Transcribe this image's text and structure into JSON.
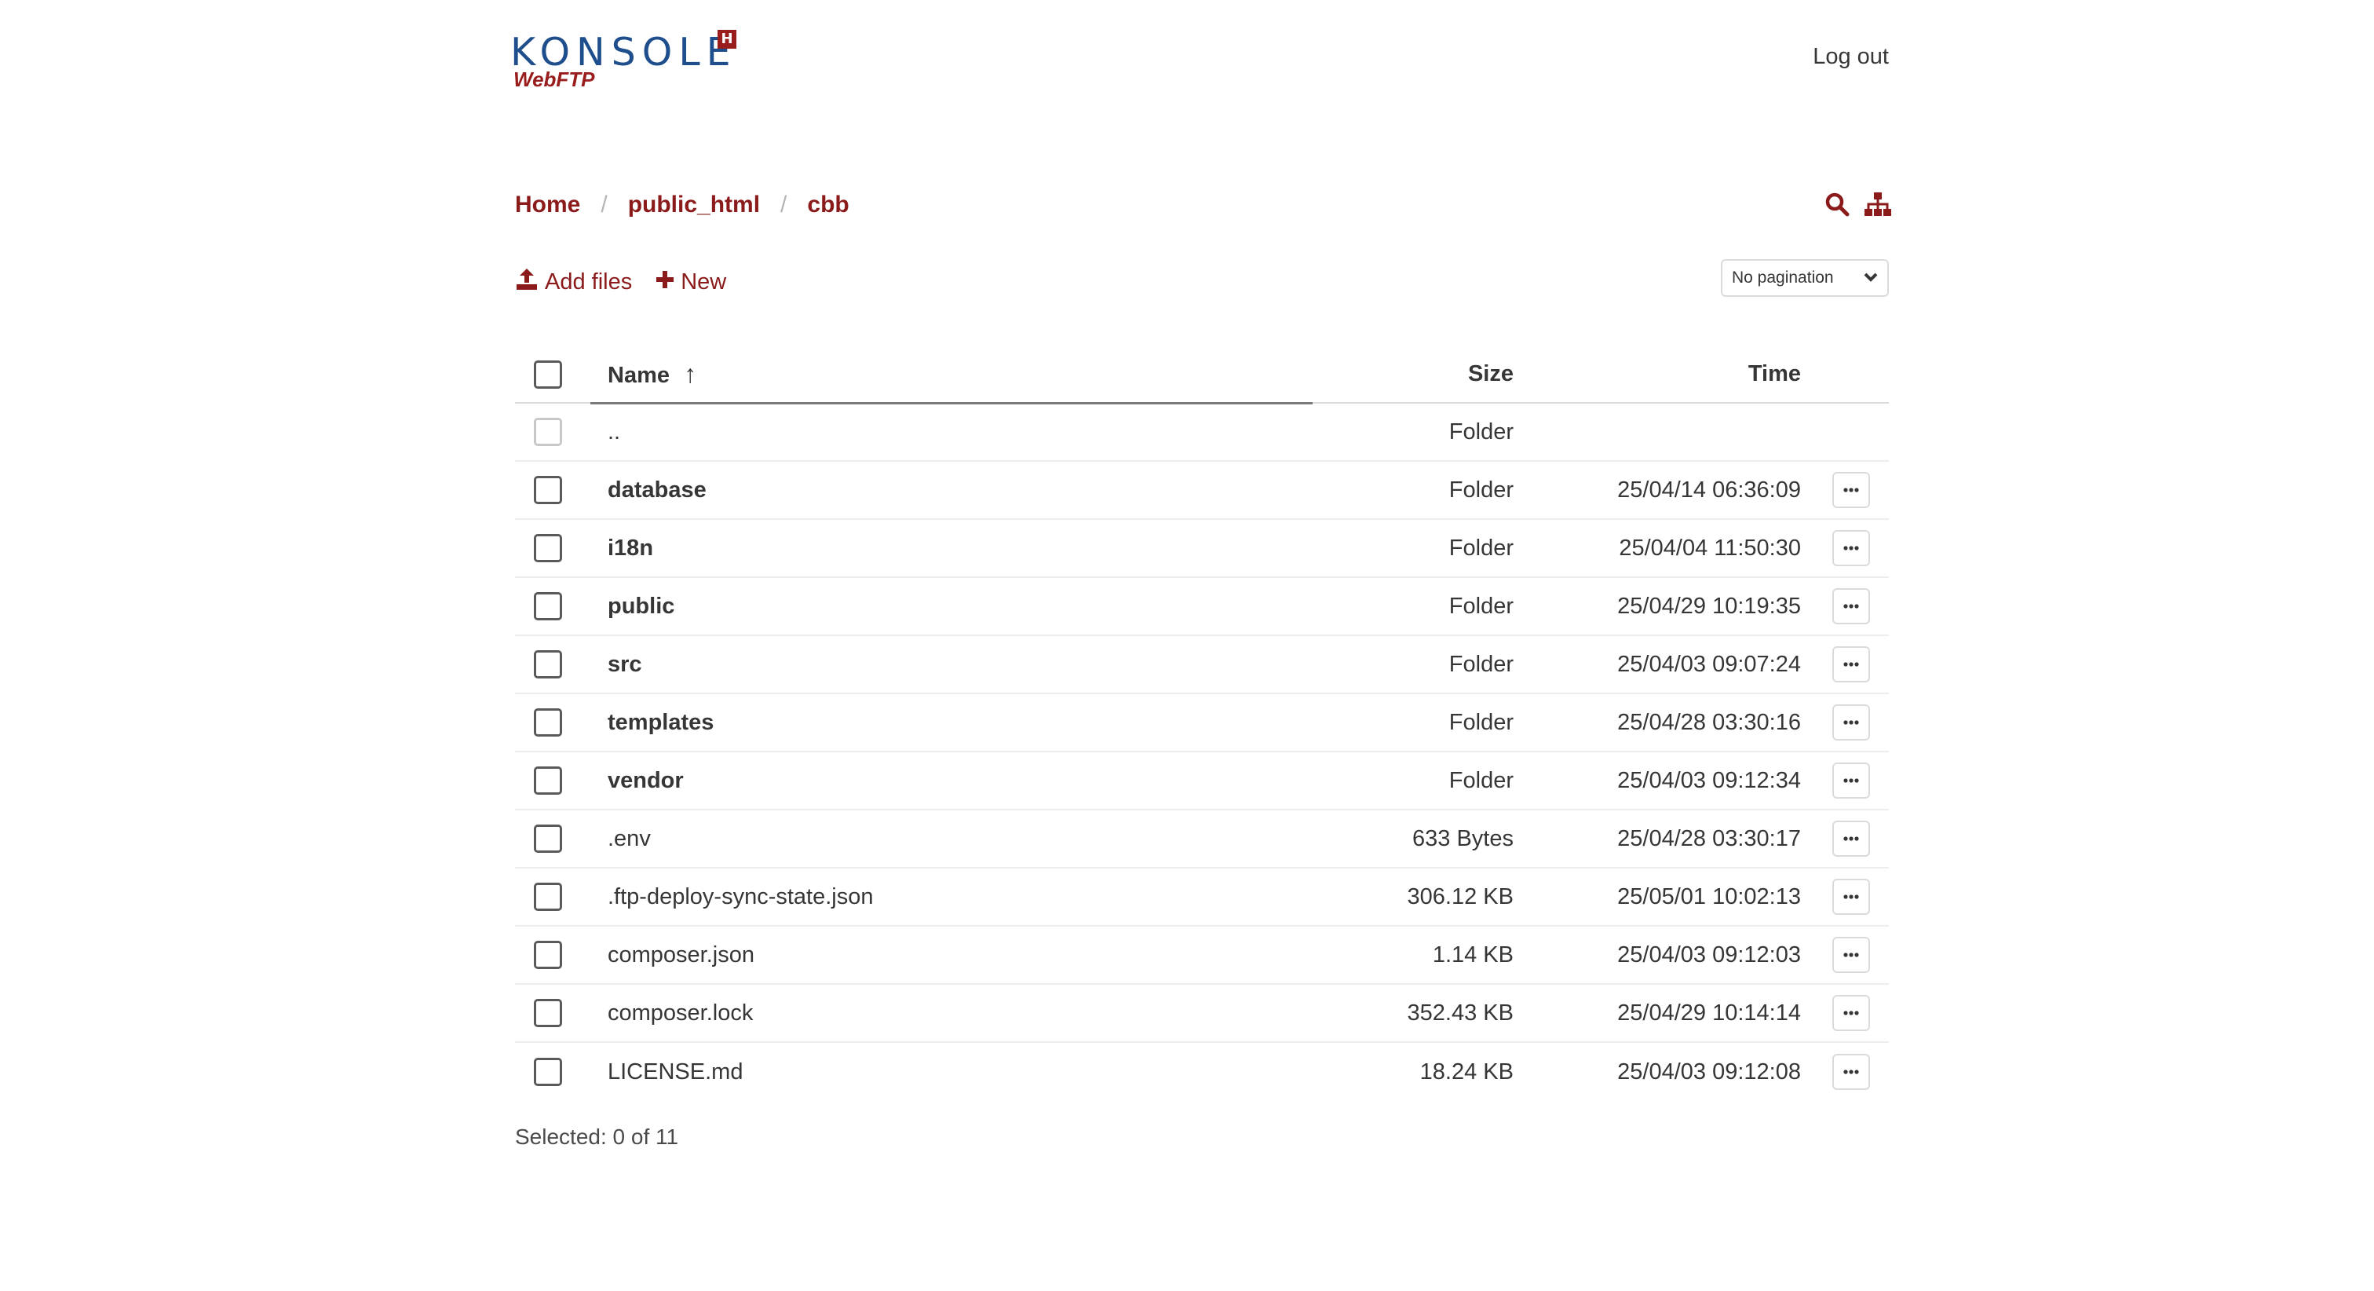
{
  "app": {
    "logo_text": "KONSOLE",
    "logo_badge": "H",
    "logo_subtitle": "WebFTP",
    "logout_label": "Log out",
    "brand_color": "#8b1a1a",
    "logo_blue": "#1f4e8c"
  },
  "breadcrumb": [
    {
      "label": "Home"
    },
    {
      "label": "public_html"
    },
    {
      "label": "cbb"
    }
  ],
  "top_icons": [
    "search-icon",
    "sitemap-icon"
  ],
  "toolbar": {
    "add_files_label": "Add files",
    "new_label": "New",
    "pagination_value": "No pagination"
  },
  "table": {
    "columns": {
      "name": "Name",
      "size": "Size",
      "time": "Time"
    },
    "sort_indicator": "↑",
    "rows": [
      {
        "name": "..",
        "size": "Folder",
        "time": "",
        "folder": false,
        "parent": true
      },
      {
        "name": "database",
        "size": "Folder",
        "time": "25/04/14 06:36:09",
        "folder": true
      },
      {
        "name": "i18n",
        "size": "Folder",
        "time": "25/04/04 11:50:30",
        "folder": true
      },
      {
        "name": "public",
        "size": "Folder",
        "time": "25/04/29 10:19:35",
        "folder": true
      },
      {
        "name": "src",
        "size": "Folder",
        "time": "25/04/03 09:07:24",
        "folder": true
      },
      {
        "name": "templates",
        "size": "Folder",
        "time": "25/04/28 03:30:16",
        "folder": true
      },
      {
        "name": "vendor",
        "size": "Folder",
        "time": "25/04/03 09:12:34",
        "folder": true
      },
      {
        "name": ".env",
        "size": "633 Bytes",
        "time": "25/04/28 03:30:17",
        "folder": false
      },
      {
        "name": ".ftp-deploy-sync-state.json",
        "size": "306.12 KB",
        "time": "25/05/01 10:02:13",
        "folder": false
      },
      {
        "name": "composer.json",
        "size": "1.14 KB",
        "time": "25/04/03 09:12:03",
        "folder": false
      },
      {
        "name": "composer.lock",
        "size": "352.43 KB",
        "time": "25/04/29 10:14:14",
        "folder": false
      },
      {
        "name": "LICENSE.md",
        "size": "18.24 KB",
        "time": "25/04/03 09:12:08",
        "folder": false
      }
    ]
  },
  "footer": {
    "selected_label": "Selected: 0 of 11"
  }
}
